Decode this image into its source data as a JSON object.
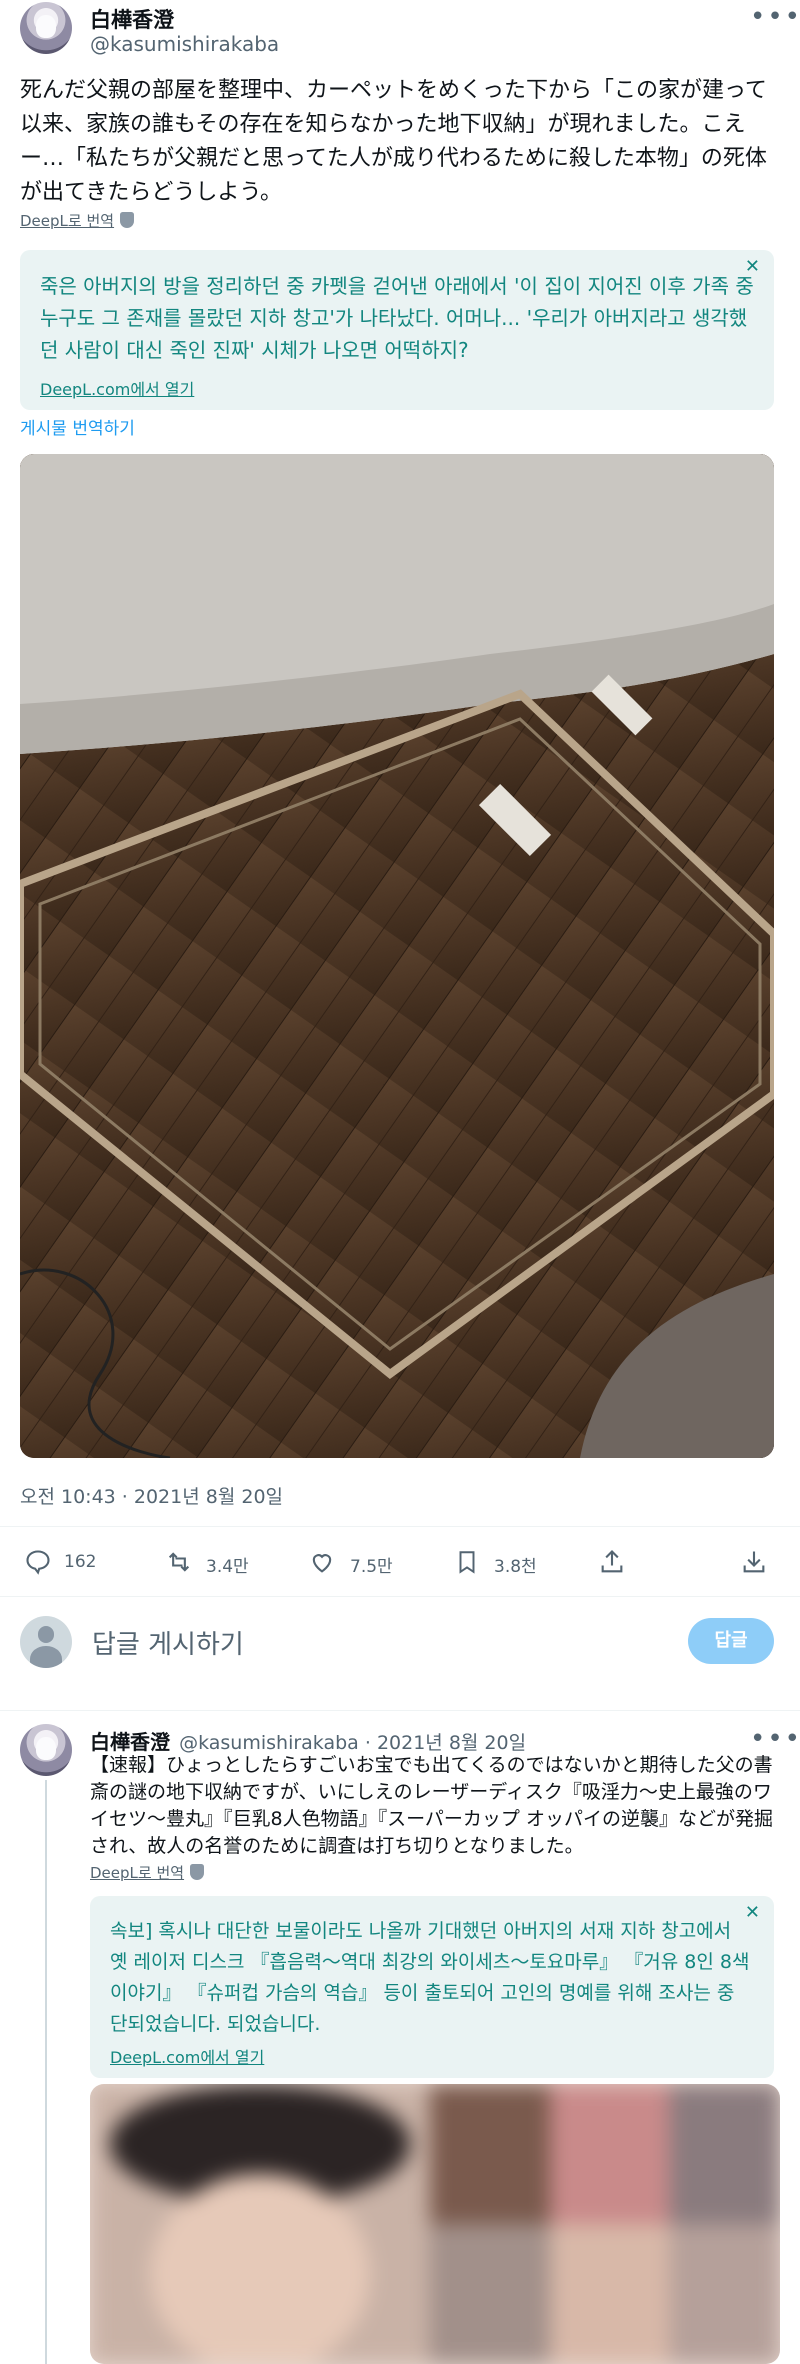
{
  "tweet": {
    "author_name": "白樺香澄",
    "author_handle": "@kasumishirakaba",
    "text": "死んだ父親の部屋を整理中、カーペットをめくった下から「この家が建って以来、家族の誰もその存在を知らなかった地下収納」が現れました。こえー…「私たちが父親だと思ってた人が成り代わるために殺した本物」の死体が出てきたらどうしよう。",
    "deepl_label": "DeepL로 번역",
    "translation": "죽은 아버지의 방을 정리하던 중 카펫을 걷어낸 아래에서 '이 집이 지어진 이후 가족 중 누구도 그 존재를 몰랐던 지하 창고'가 나타났다. 어머나... '우리가 아버지라고 생각했던 사람이 대신 죽인 진짜' 시체가 나오면 어떡하지?",
    "translation_link": "DeepL.com에서 열기",
    "translate_post": "게시물 번역하기",
    "timestamp": "오전 10:43 · 2021년 8월 20일",
    "stats": {
      "replies": "162",
      "retweets": "3.4만",
      "likes": "7.5만",
      "bookmarks": "3.8천"
    }
  },
  "composer": {
    "placeholder": "답글 게시하기",
    "button": "답글"
  },
  "reply": {
    "author_name": "白樺香澄",
    "meta": "@kasumishirakaba · 2021년 8월 20일",
    "text": "【速報】ひょっとしたらすごいお宝でも出てくるのではないかと期待した父の書斎の謎の地下収納ですが、いにしえのレーザーディスク『吸淫力～史上最強のワイセツ～豊丸』『巨乳8人色物語』『スーパーカップ オッパイの逆襲』などが発掘され、故人の名誉のために調査は打ち切りとなりました。",
    "deepl_label": "DeepL로 번역",
    "translation": "속보] 혹시나 대단한 보물이라도 나올까 기대했던 아버지의 서재 지하 창고에서 옛 레이저 디스크 『흡음력～역대 최강의 와이세츠～토요마루』 『거유 8인 8색 이야기』 『슈퍼컵 가슴의 역습』 등이 출토되어 고인의 명예를 위해 조사는 중단되었습니다. 되었습니다.",
    "translation_link": "DeepL.com에서 열기"
  },
  "icons": {
    "more": "more-icon",
    "reply": "reply-icon",
    "retweet": "retweet-icon",
    "like": "like-icon",
    "bookmark": "bookmark-icon",
    "share": "share-icon",
    "download": "download-icon"
  },
  "colors": {
    "accent": "#1d9bf0",
    "translation_text": "#12867f",
    "translation_bg": "#eaf3f3",
    "muted": "#536471"
  }
}
